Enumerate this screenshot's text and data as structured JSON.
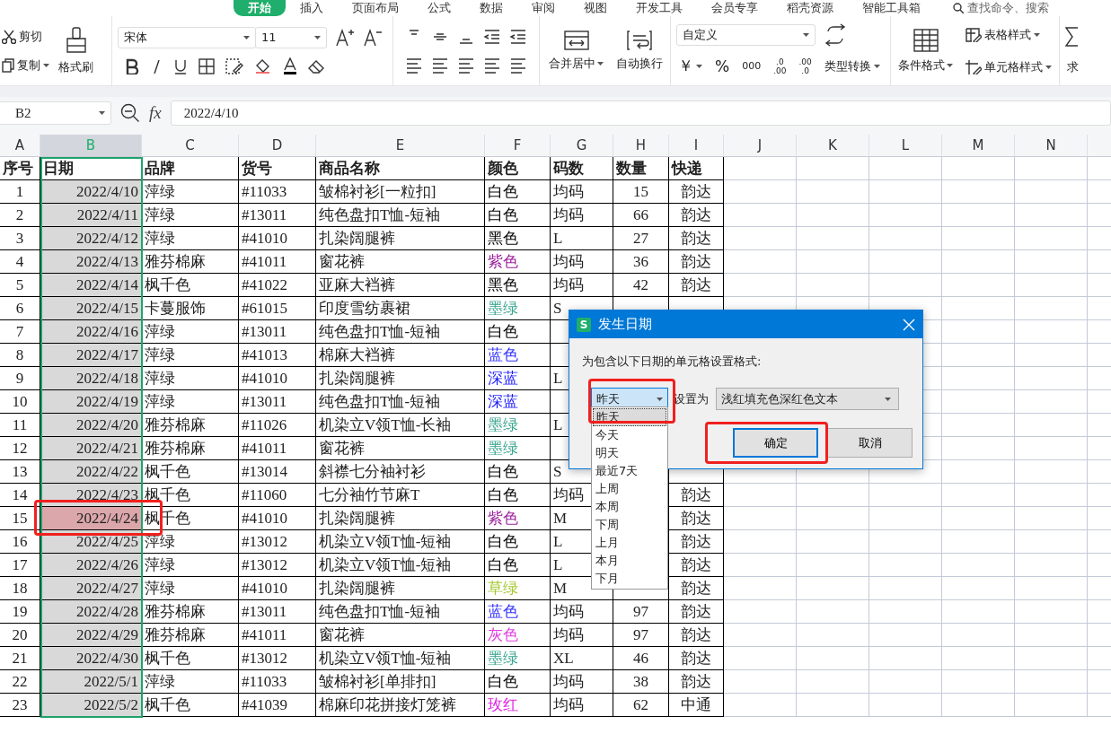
{
  "menu_tabs": [
    {
      "label": "开始",
      "selected": true
    },
    {
      "label": "插入",
      "selected": false
    },
    {
      "label": "页面布局",
      "selected": false
    },
    {
      "label": "公式",
      "selected": false
    },
    {
      "label": "数据",
      "selected": false
    },
    {
      "label": "审阅",
      "selected": false
    },
    {
      "label": "视图",
      "selected": false
    },
    {
      "label": "开发工具",
      "selected": false
    },
    {
      "label": "会员专享",
      "selected": false
    },
    {
      "label": "稻壳资源",
      "selected": false
    },
    {
      "label": "智能工具箱",
      "selected": false
    }
  ],
  "command_search": {
    "placeholder": "查找命令、搜索"
  },
  "ribbon": {
    "cut": "剪切",
    "copy": "复制",
    "format_painter": "格式刷",
    "font": "宋体",
    "font_size": "11",
    "merge": "合并居中",
    "wrap": "自动换行",
    "number_format": "自定义",
    "currency": "￥",
    "percent": "%",
    "thousands": "000",
    "decimal_add": [
      ".0",
      ".00"
    ],
    "decimal_remove": [
      ".00",
      ".0"
    ],
    "convert": "类型转换",
    "conditional": "条件格式",
    "table_style": "表格样式",
    "cell_style": "单元格样式",
    "sum_cut": "求"
  },
  "formula_bar": {
    "cell_ref": "B2",
    "fx": "fx",
    "value": "2022/4/10"
  },
  "sheet": {
    "columns": [
      {
        "label": "A",
        "selected": false
      },
      {
        "label": "B",
        "selected": true
      },
      {
        "label": "C",
        "selected": false
      },
      {
        "label": "D",
        "selected": false
      },
      {
        "label": "E",
        "selected": false
      },
      {
        "label": "F",
        "selected": false
      },
      {
        "label": "G",
        "selected": false
      },
      {
        "label": "H",
        "selected": false
      },
      {
        "label": "I",
        "selected": false
      },
      {
        "label": "J",
        "selected": false
      },
      {
        "label": "K",
        "selected": false
      },
      {
        "label": "L",
        "selected": false
      },
      {
        "label": "M",
        "selected": false
      },
      {
        "label": "N",
        "selected": false
      }
    ],
    "header": [
      "序号",
      "日期",
      "品牌",
      "货号",
      "商品名称",
      "颜色",
      "码数",
      "数量",
      "快递"
    ],
    "rows": [
      {
        "no": "1",
        "date": "2022/4/10",
        "brand": "萍绿",
        "code": "#11033",
        "name": "皱棉衬衫[一粒扣]",
        "color_name": "白色",
        "color": "#000000",
        "size": "均码",
        "qty": "15",
        "courier": "韵达",
        "marked": false
      },
      {
        "no": "2",
        "date": "2022/4/11",
        "brand": "萍绿",
        "code": "#13011",
        "name": "纯色盘扣T恤-短袖",
        "color_name": "白色",
        "color": "#000000",
        "size": "均码",
        "qty": "66",
        "courier": "韵达",
        "marked": false
      },
      {
        "no": "3",
        "date": "2022/4/12",
        "brand": "萍绿",
        "code": "#41010",
        "name": "扎染阔腿裤",
        "color_name": "黑色",
        "color": "#000000",
        "size": "L",
        "qty": "27",
        "courier": "韵达",
        "marked": false
      },
      {
        "no": "4",
        "date": "2022/4/13",
        "brand": "雅芬棉麻",
        "code": "#41011",
        "name": "窗花裤",
        "color_name": "紫色",
        "color": "#9b1f9b",
        "size": "均码",
        "qty": "36",
        "courier": "韵达",
        "marked": false
      },
      {
        "no": "5",
        "date": "2022/4/14",
        "brand": "枫千色",
        "code": "#41022",
        "name": "亚麻大裆裤",
        "color_name": "黑色",
        "color": "#000000",
        "size": "均码",
        "qty": "42",
        "courier": "韵达",
        "marked": false
      },
      {
        "no": "6",
        "date": "2022/4/15",
        "brand": "卡蔓服饰",
        "code": "#61015",
        "name": "印度雪纺裹裙",
        "color_name": "墨绿",
        "color": "#3aa58f",
        "size": "S",
        "marked": false
      },
      {
        "no": "7",
        "date": "2022/4/16",
        "brand": "萍绿",
        "code": "#13011",
        "name": "纯色盘扣T恤-短袖",
        "color_name": "白色",
        "color": "#000000",
        "marked": false
      },
      {
        "no": "8",
        "date": "2022/4/17",
        "brand": "萍绿",
        "code": "#41013",
        "name": "棉麻大裆裤",
        "color_name": "蓝色",
        "color": "#3333ff",
        "marked": false
      },
      {
        "no": "9",
        "date": "2022/4/18",
        "brand": "萍绿",
        "code": "#41010",
        "name": "扎染阔腿裤",
        "color_name": "深蓝",
        "color": "#1a1aff",
        "size": "L",
        "marked": false
      },
      {
        "no": "10",
        "date": "2022/4/19",
        "brand": "萍绿",
        "code": "#13011",
        "name": "纯色盘扣T恤-短袖",
        "color_name": "深蓝",
        "color": "#1a1aff",
        "marked": false
      },
      {
        "no": "11",
        "date": "2022/4/20",
        "brand": "雅芬棉麻",
        "code": "#11026",
        "name": "机染立V领T恤-长袖",
        "color_name": "墨绿",
        "color": "#3aa58f",
        "size": "L",
        "marked": false
      },
      {
        "no": "12",
        "date": "2022/4/21",
        "brand": "雅芬棉麻",
        "code": "#41011",
        "name": "窗花裤",
        "color_name": "墨绿",
        "color": "#3aa58f",
        "marked": false
      },
      {
        "no": "13",
        "date": "2022/4/22",
        "brand": "枫千色",
        "code": "#13014",
        "name": "斜襟七分袖衬衫",
        "color_name": "白色",
        "color": "#000000",
        "size": "S",
        "marked": false
      },
      {
        "no": "14",
        "date": "2022/4/23",
        "brand": "枫千色",
        "code": "#11060",
        "name": "七分袖竹节麻T",
        "color_name": "白色",
        "color": "#000000",
        "size": "均码",
        "courier": "韵达",
        "marked": false
      },
      {
        "no": "15",
        "date": "2022/4/24",
        "brand": "枫千色",
        "code": "#41010",
        "name": "扎染阔腿裤",
        "color_name": "紫色",
        "color": "#9b1f9b",
        "size": "M",
        "courier": "韵达",
        "marked": true
      },
      {
        "no": "16",
        "date": "2022/4/25",
        "brand": "萍绿",
        "code": "#13012",
        "name": "机染立V领T恤-短袖",
        "color_name": "白色",
        "color": "#000000",
        "size": "L",
        "courier": "韵达",
        "marked": false
      },
      {
        "no": "17",
        "date": "2022/4/26",
        "brand": "萍绿",
        "code": "#13012",
        "name": "机染立V领T恤-短袖",
        "color_name": "白色",
        "color": "#000000",
        "size": "L",
        "courier": "韵达",
        "marked": false
      },
      {
        "no": "18",
        "date": "2022/4/27",
        "brand": "萍绿",
        "code": "#41010",
        "name": "扎染阔腿裤",
        "color_name": "草绿",
        "color": "#a4c92f",
        "size": "M",
        "courier": "韵达",
        "marked": false
      },
      {
        "no": "19",
        "date": "2022/4/28",
        "brand": "雅芬棉麻",
        "code": "#13011",
        "name": "纯色盘扣T恤-短袖",
        "color_name": "蓝色",
        "color": "#3333ff",
        "size": "均码",
        "qty": "97",
        "courier": "韵达",
        "marked": false
      },
      {
        "no": "20",
        "date": "2022/4/29",
        "brand": "雅芬棉麻",
        "code": "#41011",
        "name": "窗花裤",
        "color_name": "灰色",
        "color": "#e040e0",
        "size": "均码",
        "qty": "97",
        "courier": "韵达",
        "marked": false
      },
      {
        "no": "21",
        "date": "2022/4/30",
        "brand": "枫千色",
        "code": "#13012",
        "name": "机染立V领T恤-短袖",
        "color_name": "墨绿",
        "color": "#3aa58f",
        "size": "XL",
        "qty": "46",
        "courier": "韵达",
        "marked": false
      },
      {
        "no": "22",
        "date": "2022/5/1",
        "brand": "萍绿",
        "code": "#11033",
        "name": "皱棉衬衫[单排扣]",
        "color_name": "白色",
        "color": "#000000",
        "size": "均码",
        "qty": "38",
        "courier": "韵达",
        "marked": false
      },
      {
        "no": "23",
        "date": "2022/5/2",
        "brand": "枫千色",
        "code": "#41039",
        "name": "棉麻印花拼接灯笼裤",
        "color_name": "玫红",
        "color": "#e020e0",
        "size": "均码",
        "qty": "62",
        "courier": "中通",
        "marked": false
      }
    ]
  },
  "dialog": {
    "badge": "S",
    "title": "发生日期",
    "prompt": "为包含以下日期的单元格设置格式:",
    "period": "昨天",
    "set_label": "设置为",
    "style": "浅红填充色深红色文本",
    "ok": "确定",
    "cancel": "取消",
    "options": [
      {
        "label": "昨天",
        "selected": true
      },
      {
        "label": "今天",
        "selected": false
      },
      {
        "label": "明天",
        "selected": false
      },
      {
        "label": "最近7天",
        "selected": false
      },
      {
        "label": "上周",
        "selected": false
      },
      {
        "label": "本周",
        "selected": false
      },
      {
        "label": "下周",
        "selected": false
      },
      {
        "label": "上月",
        "selected": false
      },
      {
        "label": "本月",
        "selected": false
      },
      {
        "label": "下月",
        "selected": false
      }
    ]
  }
}
